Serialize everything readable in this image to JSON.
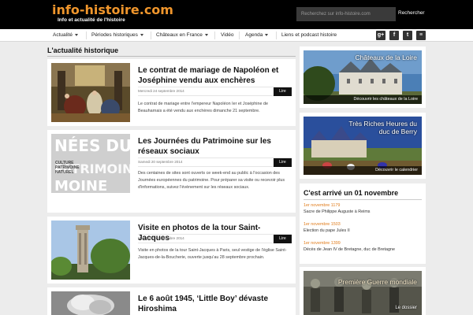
{
  "header": {
    "logo": "info-histoire.com",
    "tagline": "Info et actualité de l'histoire",
    "search_placeholder": "Recherchez sur info-histoire.com",
    "search_button": "Rechercher"
  },
  "nav": {
    "items": [
      {
        "label": "Actualité",
        "dropdown": true
      },
      {
        "label": "Périodes historiques",
        "dropdown": true
      },
      {
        "label": "Châteaux en France",
        "dropdown": true
      },
      {
        "label": "Vidéo",
        "dropdown": false
      },
      {
        "label": "Agenda",
        "dropdown": true
      },
      {
        "label": "Liens et podcast histoire",
        "dropdown": false
      }
    ],
    "social": [
      "google-plus-icon",
      "facebook-icon",
      "twitter-icon",
      "rss-icon"
    ],
    "social_glyphs": [
      "g+",
      "f",
      "t",
      "≡"
    ]
  },
  "main": {
    "section_title": "L'actualité historique",
    "read_label": "Lire",
    "articles": [
      {
        "title": "Le contrat de mariage de Napoléon et Joséphine vendu aux enchères",
        "date": "Mercredi 24 septembre 2014",
        "excerpt": "Le contrat de mariage entre l'empereur Napoléon Ier et Joséphine de Beauharnais a été vendu aux enchères dimanche 21 septembre."
      },
      {
        "title": "Les Journées du Patrimoine sur les réseaux sociaux",
        "date": "Samedi 20 septembre 2014",
        "excerpt": "Des centaines de sites sont ouverts ce week-end au public à l'occasion des Journées européennes du patrimoine. Pour préparer sa visite ou recevoir plus d'informations, suivez l'évènement sur les réseaux sociaux.",
        "thumb_text": [
          "NÉES DU",
          "PATRIMOINE",
          "CULTURE",
          "PATRIMOINE",
          "NATUREL",
          "MOINE"
        ]
      },
      {
        "title": "Visite en photos de la tour Saint-Jacques",
        "date": "Mercredi 17 septembre 2014",
        "excerpt": "Visite en photos de la tour Saint-Jacques à Paris, seul vestige de l'église Saint-Jacques-de-la-Boucherie, ouverte jusqu'au 28 septembre prochain."
      },
      {
        "title": "Le 6 août 1945, ‘Little Boy’ dévaste Hiroshima"
      }
    ]
  },
  "sidebar": {
    "banners": [
      {
        "title": "Châteaux de la Loire",
        "caption": "Découvrir les châteaux de la Loire"
      },
      {
        "title": "Très Riches Heures du duc de Berry",
        "caption": "Découvrir le calendrier"
      }
    ],
    "on_this_day": {
      "title": "C'est arrivé un 01 novembre",
      "events": [
        {
          "date": "1er novembre 1179",
          "text": "Sacre de Philippe Auguste à Reims"
        },
        {
          "date": "1er novembre 1503",
          "text": "Election du pape Jules II"
        },
        {
          "date": "1er novembre 1399",
          "text": "Décès de Jean IV de Bretagne, duc de Bretagne"
        }
      ]
    },
    "ww1": {
      "title": "Première Guerre mondiale",
      "caption": "Le dossier"
    }
  }
}
